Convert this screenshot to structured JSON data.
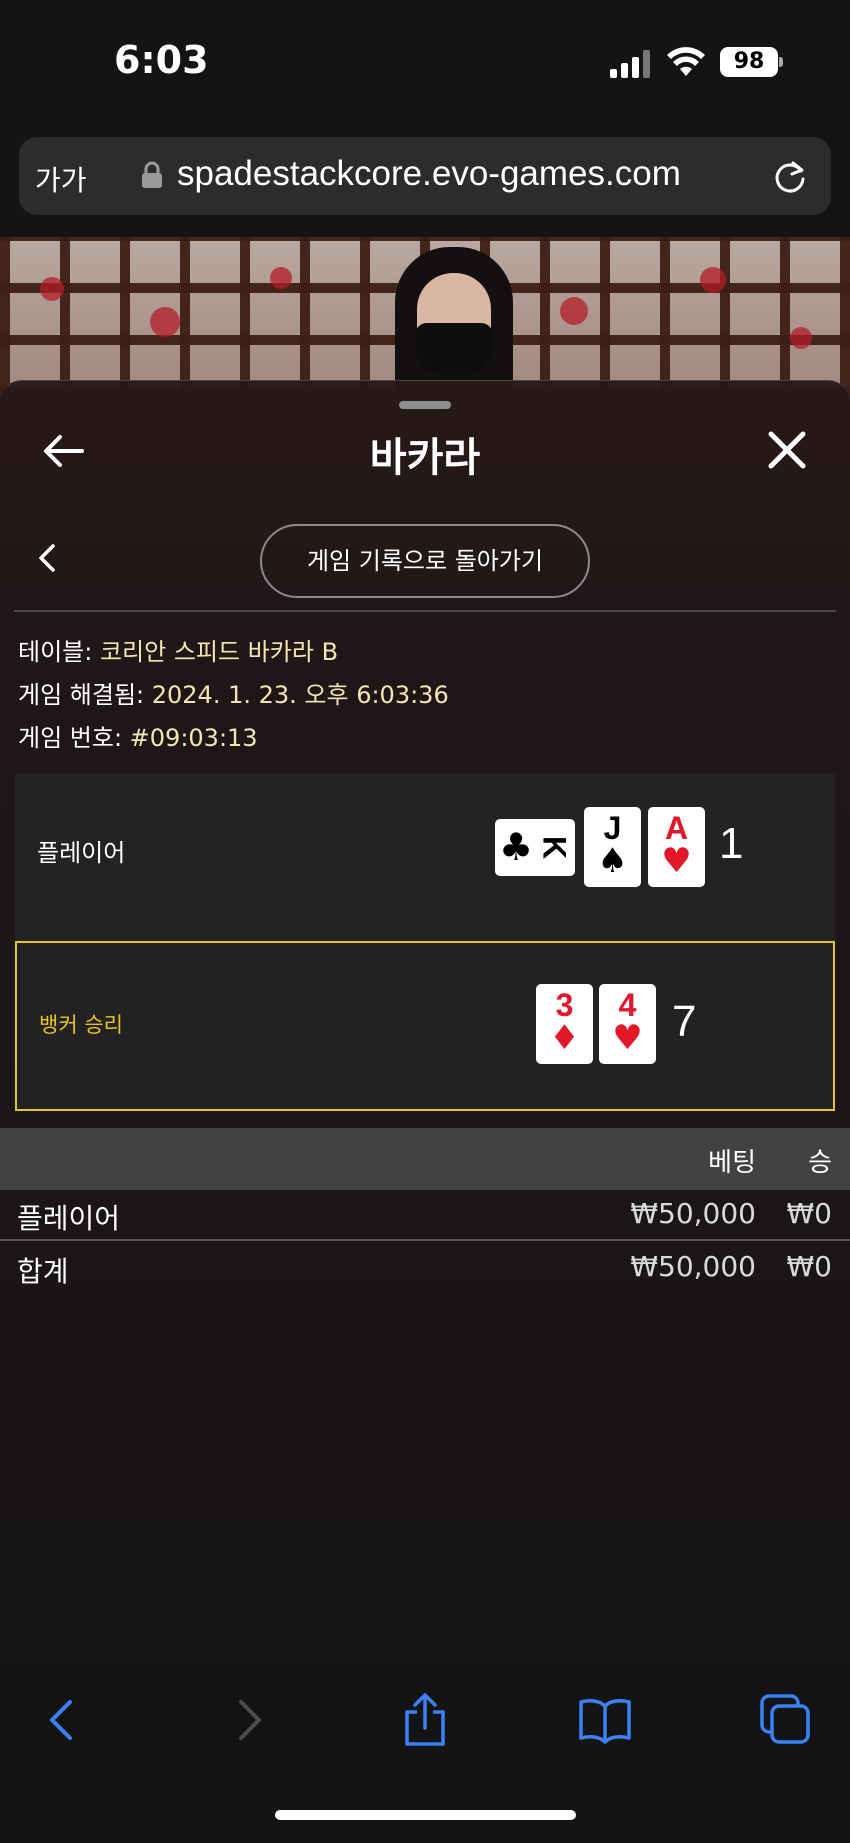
{
  "status_bar": {
    "time": "6:03",
    "battery": "98",
    "icons": [
      "signal-icon",
      "wifi-icon",
      "battery-icon"
    ]
  },
  "browser": {
    "text_size_label": "가가",
    "url": "spadestackcore.evo-games.com",
    "icons": [
      "lock-icon",
      "reload-icon"
    ]
  },
  "panel": {
    "title": "바카라",
    "back_icon": "arrow-left-icon",
    "close_icon": "close-icon",
    "history_button": "게임 기록으로 돌아가기",
    "info": {
      "table_label": "테이블: ",
      "table_value": "코리안 스피드 바카라 B",
      "resolved_label": "게임 해결됨: ",
      "resolved_value": "2024. 1. 23. 오후 6:03:36",
      "game_no_label": "게임 번호: ",
      "game_no_value": "#09:03:13"
    },
    "hands": {
      "player": {
        "label": "플레이어",
        "score": "1",
        "cards": [
          {
            "rank": "K",
            "suit": "♣",
            "color": "black",
            "orientation": "sideways"
          },
          {
            "rank": "J",
            "suit": "♠",
            "color": "black"
          },
          {
            "rank": "A",
            "suit": "♥",
            "color": "red"
          }
        ]
      },
      "banker": {
        "label": "뱅커 승리",
        "score": "7",
        "winner": true,
        "cards": [
          {
            "rank": "3",
            "suit": "♦",
            "color": "red"
          },
          {
            "rank": "4",
            "suit": "♥",
            "color": "red"
          }
        ]
      }
    },
    "bets": {
      "header_bet": "베팅",
      "header_win": "승",
      "rows": [
        {
          "label": "플레이어",
          "bet": "₩50,000",
          "win": "₩0"
        },
        {
          "label": "합계",
          "bet": "₩50,000",
          "win": "₩0"
        }
      ]
    }
  },
  "toolbar": {
    "icons": [
      "back-icon",
      "forward-icon",
      "share-icon",
      "bookmarks-icon",
      "tabs-icon"
    ]
  },
  "colors": {
    "accent_gold": "#e7c521",
    "info_value": "#f3e6b2",
    "ios_blue": "#3b82f6",
    "card_red": "#e0182a"
  }
}
